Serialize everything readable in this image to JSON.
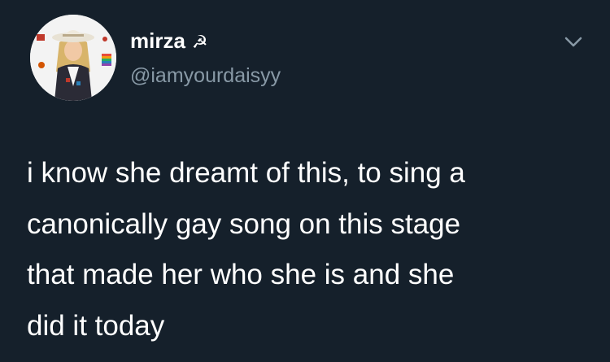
{
  "colors": {
    "background": "#15202b",
    "primary_text": "#ffffff",
    "secondary_text": "#8899a6"
  },
  "tweet": {
    "avatar": "profile-photo",
    "display_name": "mirza",
    "name_emoji": "☭",
    "handle": "@iamyourdaisyy",
    "menu_icon": "chevron-down-icon",
    "text_lines": [
      "i know she dreamt of this, to sing a",
      "canonically gay song on this stage",
      "that made her who she is and she",
      "did it today"
    ]
  }
}
